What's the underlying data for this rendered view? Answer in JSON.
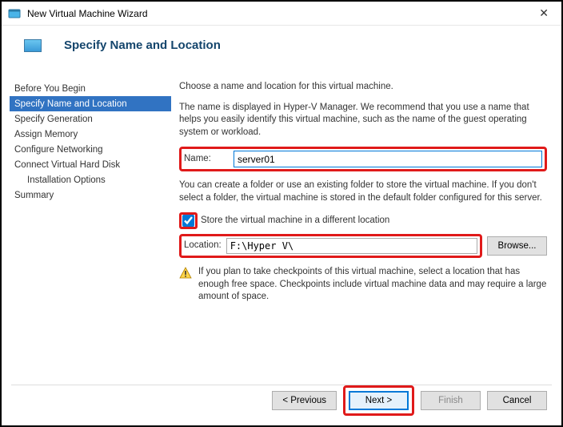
{
  "window": {
    "title": "New Virtual Machine Wizard"
  },
  "header": {
    "title": "Specify Name and Location"
  },
  "sidebar": {
    "items": [
      {
        "label": "Before You Begin"
      },
      {
        "label": "Specify Name and Location"
      },
      {
        "label": "Specify Generation"
      },
      {
        "label": "Assign Memory"
      },
      {
        "label": "Configure Networking"
      },
      {
        "label": "Connect Virtual Hard Disk"
      },
      {
        "label": "Installation Options"
      },
      {
        "label": "Summary"
      }
    ],
    "activeIndex": 1
  },
  "content": {
    "intro": "Choose a name and location for this virtual machine.",
    "nameHelp": "The name is displayed in Hyper-V Manager. We recommend that you use a name that helps you easily identify this virtual machine, such as the name of the guest operating system or workload.",
    "nameLabel": "Name:",
    "nameValue": "server01",
    "folderHelp": "You can create a folder or use an existing folder to store the virtual machine. If you don't select a folder, the virtual machine is stored in the default folder configured for this server.",
    "storeCheckboxLabel": "Store the virtual machine in a different location",
    "storeChecked": true,
    "locationLabel": "Location:",
    "locationValue": "F:\\Hyper V\\",
    "browseLabel": "Browse...",
    "warning": "If you plan to take checkpoints of this virtual machine, select a location that has enough free space. Checkpoints include virtual machine data and may require a large amount of space."
  },
  "buttons": {
    "previous": "< Previous",
    "next": "Next >",
    "finish": "Finish",
    "cancel": "Cancel"
  }
}
